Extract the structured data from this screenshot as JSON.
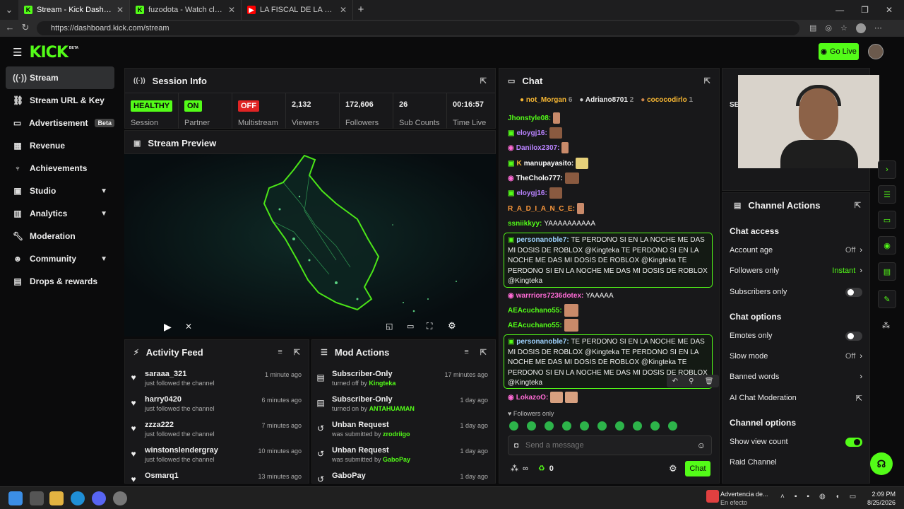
{
  "browser": {
    "tabs": [
      {
        "title": "Stream - Kick Dashboard",
        "active": true
      },
      {
        "title": "fuzodota - Watch clips on Kick",
        "active": false
      },
      {
        "title": "LA FISCAL DE LA NOCHE - PIURA",
        "active": false
      }
    ],
    "url": "https://dashboard.kick.com/stream"
  },
  "header": {
    "logo": "KICK",
    "beta": "BETA",
    "go_live": "Go Live"
  },
  "sidebar": {
    "items": [
      {
        "label": "Stream",
        "icon": "broadcast-icon",
        "active": true
      },
      {
        "label": "Stream URL & Key",
        "icon": "link-icon"
      },
      {
        "label": "Advertisement",
        "icon": "tv-icon",
        "badge": "Beta"
      },
      {
        "label": "Revenue",
        "icon": "chart-icon"
      },
      {
        "label": "Achievements",
        "icon": "trophy-icon"
      },
      {
        "label": "Studio",
        "icon": "studio-icon",
        "expandable": true
      },
      {
        "label": "Analytics",
        "icon": "analytics-icon",
        "expandable": true
      },
      {
        "label": "Moderation",
        "icon": "wrench-icon"
      },
      {
        "label": "Community",
        "icon": "community-icon",
        "expandable": true
      },
      {
        "label": "Drops & rewards",
        "icon": "gift-icon"
      }
    ]
  },
  "session": {
    "title": "Session Info",
    "stats": [
      {
        "pill": "HEALTHY",
        "label": "Session"
      },
      {
        "pill": "ON",
        "label": "Partner"
      },
      {
        "pill": "OFF",
        "label": "Multistream"
      },
      {
        "value": "2,132",
        "label": "Viewers"
      },
      {
        "value": "172,606",
        "label": "Followers"
      },
      {
        "value": "26",
        "label": "Sub Counts"
      },
      {
        "value": "00:16:57",
        "label": "Time Live"
      }
    ]
  },
  "preview": {
    "title": "Stream Preview"
  },
  "activity": {
    "title": "Activity Feed",
    "items": [
      {
        "name": "saraaa_321",
        "text": "just followed the channel",
        "time": "1 minute ago"
      },
      {
        "name": "harry0420",
        "text": "just followed the channel",
        "time": "6 minutes ago"
      },
      {
        "name": "zzza222",
        "text": "just followed the channel",
        "time": "7 minutes ago"
      },
      {
        "name": "winstonslendergray",
        "text": "just followed the channel",
        "time": "10 minutes ago"
      },
      {
        "name": "Osmarq1",
        "text": "",
        "time": "13 minutes ago"
      }
    ]
  },
  "mod": {
    "title": "Mod Actions",
    "items": [
      {
        "name": "Subscriber-Only",
        "pre": "turned off by",
        "user": "Kingteka",
        "time": "17 minutes ago"
      },
      {
        "name": "Subscriber-Only",
        "pre": "turned on by",
        "user": "ANTAHUAMAN",
        "time": "1 day ago"
      },
      {
        "name": "Unban Request",
        "pre": "was submitted by",
        "user": "zrodriigo",
        "time": "1 day ago"
      },
      {
        "name": "Unban Request",
        "pre": "was submitted by",
        "user": "GaboPay",
        "time": "1 day ago"
      },
      {
        "name": "GaboPay",
        "pre": "",
        "user": "",
        "time": "1 day ago"
      }
    ]
  },
  "chat": {
    "title": "Chat",
    "top_gifters": [
      {
        "name": "not_Morgan",
        "count": "6"
      },
      {
        "name": "Adriano8701",
        "count": "2"
      },
      {
        "name": "cococodirlo",
        "count": "1"
      }
    ],
    "messages": [
      {
        "user": "Jhonstyle08:",
        "color": "#53fc18",
        "text": ""
      },
      {
        "user": "eloygj16:",
        "color": "#b983ff",
        "text": ""
      },
      {
        "user": "Danilox2307:",
        "color": "#b983ff",
        "text": ""
      },
      {
        "user": "manupayasito:",
        "color": "#ffffff",
        "text": ""
      },
      {
        "user": "TheCholo777:",
        "color": "#ffffff",
        "text": ""
      },
      {
        "user": "eloygj16:",
        "color": "#b983ff",
        "text": ""
      },
      {
        "user": "R_A_D_I_A_N_C_E:",
        "color": "#ff9a3c",
        "text": ""
      },
      {
        "user": "ssniikkyy:",
        "color": "#53fc18",
        "text": "YAAAAAAAAAA"
      }
    ],
    "highlight1": {
      "user": "personanoble7:",
      "text": "TE PERDONO SI EN LA NOCHE ME DAS MI DOSIS DE ROBLOX @Kingteka TE PERDONO SI EN LA NOCHE ME DAS MI DOSIS DE ROBLOX @Kingteka TE PERDONO SI EN LA NOCHE ME DAS MI DOSIS DE ROBLOX @Kingteka"
    },
    "messages2": [
      {
        "user": "warrriors7236dotex:",
        "color": "#ff6bd6",
        "text": "YAAAAA"
      },
      {
        "user": "AEAcuchano55:",
        "color": "#53fc18",
        "text": ""
      },
      {
        "user": "AEAcuchano55:",
        "color": "#53fc18",
        "text": ""
      }
    ],
    "highlight2": {
      "user": "personanoble7:",
      "text": "TE PERDONO SI EN LA NOCHE ME DAS MI DOSIS DE ROBLOX @Kingteka TE PERDONO SI EN LA NOCHE ME DAS MI DOSIS DE ROBLOX @Kingteka TE PERDONO SI EN LA NOCHE ME DAS MI DOSIS DE ROBLOX @Kingteka"
    },
    "last": {
      "user": "LokazoO:",
      "color": "#ff6bd6"
    },
    "followers_only": "Followers only",
    "placeholder": "Send a message",
    "viewer_count": "0",
    "chat_button": "Chat",
    "infinity": "∞"
  },
  "channel_actions": {
    "title": "Channel Actions",
    "chat_access": "Chat access",
    "account_age": {
      "label": "Account age",
      "value": "Off"
    },
    "followers_only": {
      "label": "Followers only",
      "value": "Instant"
    },
    "subscribers_only": {
      "label": "Subscribers only",
      "enabled": false
    },
    "chat_options": "Chat options",
    "emotes_only": {
      "label": "Emotes only",
      "enabled": false
    },
    "slow_mode": {
      "label": "Slow mode",
      "value": "Off"
    },
    "banned_words": {
      "label": "Banned words"
    },
    "ai_mod": {
      "label": "AI Chat Moderation"
    },
    "channel_options": "Channel options",
    "show_view_count": {
      "label": "Show view count",
      "enabled": true
    },
    "raid": {
      "label": "Raid Channel"
    }
  },
  "partial_panel_label": "SE",
  "taskbar": {
    "weather_title": "Advertencia de...",
    "weather_sub": "En efecto",
    "time": "2:09 PM",
    "date": "8/25/2026"
  },
  "colors": {
    "accent": "#53fc18",
    "panel": "#18181a",
    "bg": "#0b0b0c"
  }
}
